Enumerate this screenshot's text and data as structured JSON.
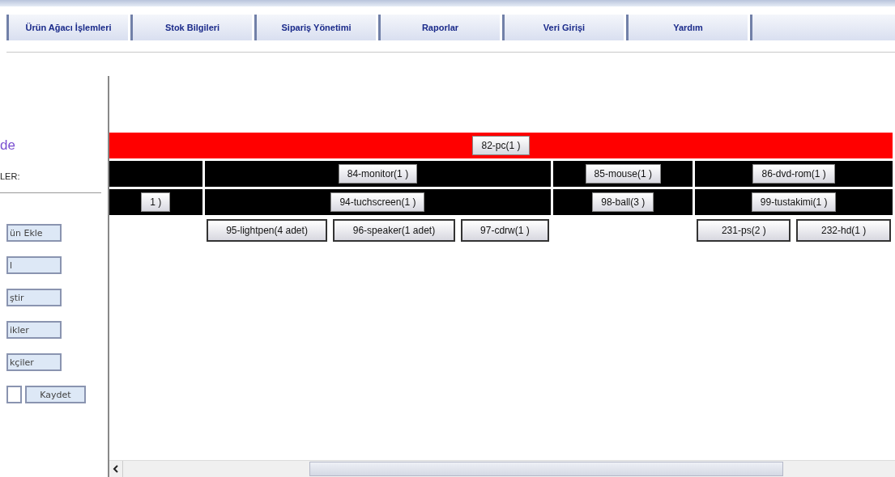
{
  "menu_tabs": [
    {
      "label": "Ürün Ağacı İşlemleri"
    },
    {
      "label": "Stok Bilgileri"
    },
    {
      "label": "Sipariş Yönetimi"
    },
    {
      "label": "Raporlar"
    },
    {
      "label": "Veri Girişi"
    },
    {
      "label": "Yardım"
    }
  ],
  "sidebar": {
    "heading": "de",
    "section_label": "LER:",
    "buttons": [
      "ün Ekle",
      "l",
      "ştir",
      "ikler",
      "kçiler"
    ],
    "save_button": "Kaydet"
  },
  "tree": {
    "label": "82-pc(1 )",
    "children": [
      {
        "children": [
          {
            "label": "1 )"
          }
        ]
      },
      {
        "label": "84-monitor(1 )",
        "children": [
          {
            "label": "94-tuchscreen(1 )",
            "children": [
              {
                "label": "95-lightpen(4 adet)"
              },
              {
                "label": "96-speaker(1 adet)"
              },
              {
                "label": "97-cdrw(1 )"
              }
            ]
          }
        ]
      },
      {
        "label": "85-mouse(1 )",
        "children": [
          {
            "label": "98-ball(3 )"
          }
        ]
      },
      {
        "label": "86-dvd-rom(1 )",
        "children": [
          {
            "label": "99-tustakimi(1 )",
            "children": [
              {
                "label": "231-ps(2 )"
              },
              {
                "label": "232-hd(1 )"
              }
            ]
          }
        ]
      }
    ]
  }
}
